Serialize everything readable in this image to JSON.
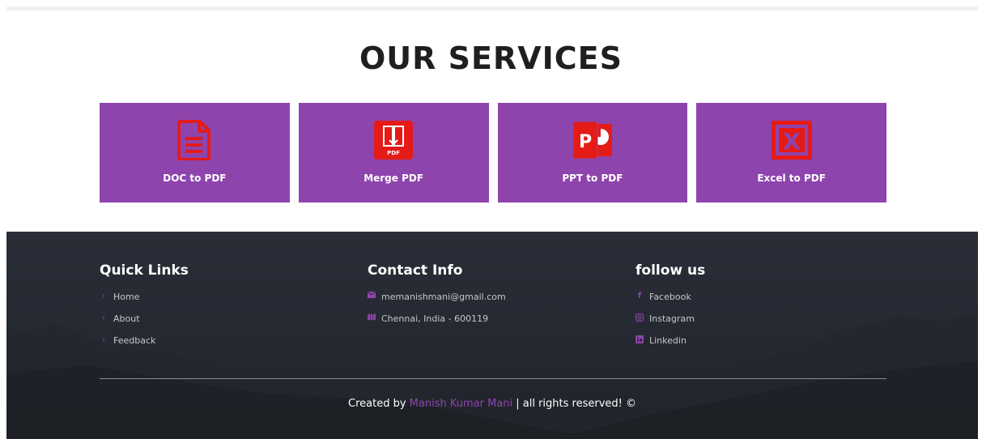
{
  "services": {
    "title": "OUR SERVICES",
    "cards": [
      {
        "label": "DOC to PDF",
        "icon": "document-icon"
      },
      {
        "label": "Merge PDF",
        "icon": "merge-pdf-icon",
        "badge": "PDF"
      },
      {
        "label": "PPT to PDF",
        "icon": "powerpoint-icon",
        "badge": "P"
      },
      {
        "label": "Excel to PDF",
        "icon": "excel-icon",
        "badge": "X"
      }
    ]
  },
  "footer": {
    "quick_links": {
      "title": "Quick Links",
      "items": [
        "Home",
        "About",
        "Feedback"
      ]
    },
    "contact": {
      "title": "Contact Info",
      "email": "memanishmani@gmail.com",
      "address": "Chennai, India - 600119"
    },
    "follow": {
      "title": "follow us",
      "items": [
        "Facebook",
        "Instagram",
        "Linkedin"
      ]
    },
    "credits": {
      "prefix": "Created by",
      "author": "Manish Kumar Mani",
      "suffix": "| all rights reserved! ©"
    }
  },
  "colors": {
    "accent": "#8e44ad",
    "icon_red": "#e41b17",
    "footer_bg": "#262932"
  }
}
